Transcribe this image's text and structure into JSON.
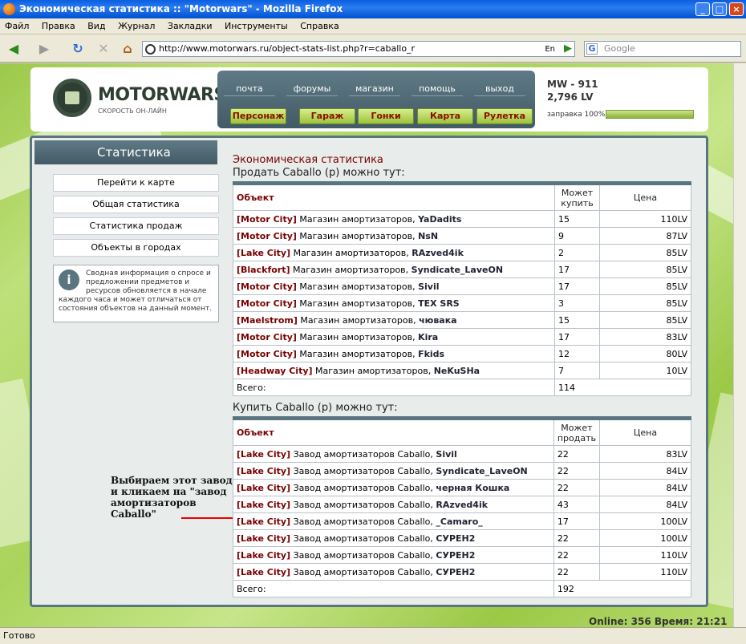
{
  "window": {
    "title": "Экономическая статистика :: \"Motorwars\" - Mozilla Firefox"
  },
  "menu": [
    "Файл",
    "Правка",
    "Вид",
    "Журнал",
    "Закладки",
    "Инструменты",
    "Справка"
  ],
  "toolbar": {
    "url": "http://www.motorwars.ru/object-stats-list.php?r=caballo_r",
    "lang": "En",
    "search_placeholder": "Google",
    "search_engine": "G"
  },
  "site": {
    "logo": "MOTORWARS.RU",
    "logo_sub": "СКОРОСТЬ ОН-ЛАЙН",
    "nav_links": [
      "почта",
      "форумы",
      "магазин",
      "помощь",
      "выход"
    ],
    "nav_buttons": [
      "Персонаж",
      "Гараж",
      "Гонки",
      "Карта",
      "Рулетка"
    ],
    "user": {
      "name": "MW - 911",
      "money": "2,796 LV",
      "fuel_label": "заправка 100%",
      "fuel_fraction": 1.0
    }
  },
  "sidebar": {
    "title": "Статистика",
    "items": [
      "Перейти к карте",
      "Общая статистика",
      "Статистика продаж",
      "Объекты в городах"
    ],
    "info_icon": "i",
    "info": "Сводная информация о спросе и предложении предметов и ресурсов обновляется в начале каждого часа и может отличаться от состояния объектов на данный момент."
  },
  "note": "Выбираем этот завод и кликаем на \"завод амортизаторов Caballo\"",
  "main": {
    "title": "Экономическая статистика",
    "sell": {
      "heading": "Продать Caballo (р) можно тут:",
      "col_object": "Объект",
      "col_qty": "Может купить",
      "col_price": "Цена",
      "rows": [
        {
          "city": "[Motor City]",
          "shop": "Магазин амортизаторов,",
          "owner": "YaDadits",
          "qty": "15",
          "price": "110LV"
        },
        {
          "city": "[Motor City]",
          "shop": "Магазин амортизаторов,",
          "owner": "NsN",
          "qty": "9",
          "price": "87LV"
        },
        {
          "city": "[Lake City]",
          "shop": "Магазин амортизаторов,",
          "owner": "RAzved4ik",
          "qty": "2",
          "price": "85LV"
        },
        {
          "city": "[Blackfort]",
          "shop": "Магазин амортизаторов,",
          "owner": "Syndicate_LaveON",
          "qty": "17",
          "price": "85LV"
        },
        {
          "city": "[Motor City]",
          "shop": "Магазин амортизаторов,",
          "owner": "Sivil",
          "qty": "17",
          "price": "85LV"
        },
        {
          "city": "[Motor City]",
          "shop": "Магазин амортизаторов,",
          "owner": "TEX SRS",
          "qty": "3",
          "price": "85LV"
        },
        {
          "city": "[Maelstrom]",
          "shop": "Магазин амортизаторов,",
          "owner": "чювака",
          "qty": "15",
          "price": "85LV"
        },
        {
          "city": "[Motor City]",
          "shop": "Магазин амортизаторов,",
          "owner": "Kira",
          "qty": "17",
          "price": "83LV"
        },
        {
          "city": "[Motor City]",
          "shop": "Магазин амортизаторов,",
          "owner": "Fkids",
          "qty": "12",
          "price": "80LV"
        },
        {
          "city": "[Headway City]",
          "shop": "Магазин амортизаторов,",
          "owner": "NeKuSHa",
          "qty": "7",
          "price": "10LV"
        }
      ],
      "total_label": "Всего:",
      "total": "114"
    },
    "buy": {
      "heading": "Купить Caballo (р) можно тут:",
      "col_object": "Объект",
      "col_qty": "Может продать",
      "col_price": "Цена",
      "rows": [
        {
          "city": "[Lake City]",
          "shop": "Завод амортизаторов Caballo,",
          "owner": "Sivil",
          "qty": "22",
          "price": "83LV"
        },
        {
          "city": "[Lake City]",
          "shop": "Завод амортизаторов Caballo,",
          "owner": "Syndicate_LaveON",
          "qty": "22",
          "price": "84LV"
        },
        {
          "city": "[Lake City]",
          "shop": "Завод амортизаторов Caballo,",
          "owner": "черная Кошка",
          "qty": "22",
          "price": "84LV"
        },
        {
          "city": "[Lake City]",
          "shop": "Завод амортизаторов Caballo,",
          "owner": "RAzved4ik",
          "qty": "43",
          "price": "84LV"
        },
        {
          "city": "[Lake City]",
          "shop": "Завод амортизаторов Caballo,",
          "owner": "_Camaro_",
          "qty": "17",
          "price": "100LV"
        },
        {
          "city": "[Lake City]",
          "shop": "Завод амортизаторов Caballo,",
          "owner": "СУРЕН2",
          "qty": "22",
          "price": "100LV"
        },
        {
          "city": "[Lake City]",
          "shop": "Завод амортизаторов Caballo,",
          "owner": "СУРЕН2",
          "qty": "22",
          "price": "110LV"
        },
        {
          "city": "[Lake City]",
          "shop": "Завод амортизаторов Caballo,",
          "owner": "СУРЕН2",
          "qty": "22",
          "price": "110LV"
        }
      ],
      "total_label": "Всего:",
      "total": "192"
    }
  },
  "footer": {
    "online": "Online: 356  Время: 21:21"
  },
  "status": "Готово"
}
